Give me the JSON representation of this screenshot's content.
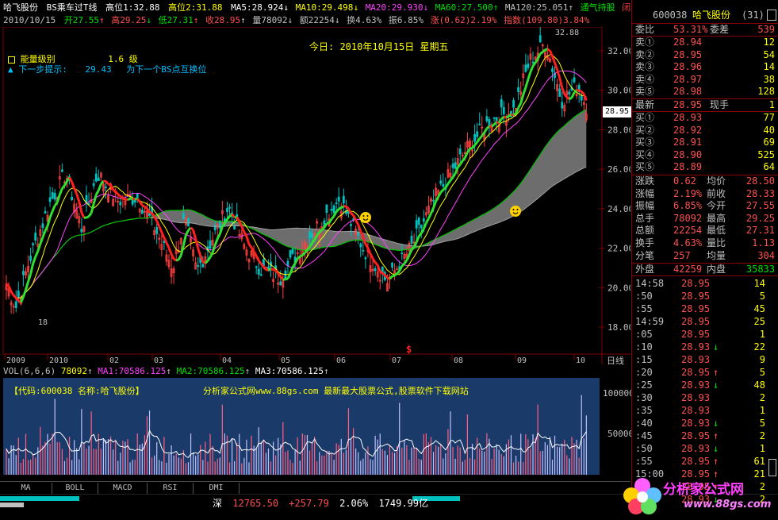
{
  "header": {
    "title": "哈飞股份",
    "formula": "BS乘车过T线",
    "high1": "高位1:32.88",
    "high2": "高位2:31.88",
    "ma5": "MA5:28.924",
    "ma10": "MA10:29.498",
    "ma20": "MA20:29.930",
    "ma60": "MA60:27.500",
    "ma120": "MA120:25.051",
    "tongqi": "通气持股",
    "xianqi": "闭气预",
    "date": "2010/10/15",
    "open": "开27.55",
    "high": "高29.25",
    "low": "低27.31",
    "close": "收28.95",
    "vol": "量78092",
    "amount": "额22254",
    "turnover": "换4.63%",
    "amplitude": "振6.85%",
    "change": "涨(0.62)2.19%",
    "index": "指数(109.80)3.84%"
  },
  "chart": {
    "today_label": "今日: 2010年10月15日 星期五",
    "energy_label": "能量级别",
    "energy_value": "1.6 级",
    "next_tip_label": "下一步提示:",
    "next_tip_value": "29.43",
    "next_tip_text": "为下一个BS点互换位",
    "peak_label": "32.88",
    "low_label": "18",
    "price_tag": "28.95",
    "y_ticks": [
      "32.00",
      "30.00",
      "28.00",
      "26.00",
      "24.00",
      "22.00",
      "20.00",
      "18.00"
    ],
    "x_ticks": [
      "2009",
      "2010",
      "02",
      "03",
      "04",
      "05",
      "06",
      "07",
      "08",
      "09",
      "10"
    ],
    "period": "日线",
    "ma_colors": {
      "ma5": "#ffffff",
      "ma10": "#ffff00",
      "ma20": "#ff40ff",
      "ma60": "#00c000",
      "ma120": "#c0c0c0"
    }
  },
  "volume": {
    "header": "VOL(6,6,6)",
    "vol": "78092",
    "ma1": "MA1:70586.125",
    "ma2": "MA2:70586.125",
    "ma3": "MA3:70586.125",
    "code_label": "【代码:600038 名称:哈飞股份】",
    "ad_text": "分析家公式网www.88gs.com 最新最大股票公式,股票软件下载网站",
    "y_ticks": [
      "100000",
      "50000"
    ]
  },
  "tabs": [
    "MA",
    "BOLL",
    "MACD",
    "RSI",
    "DMI"
  ],
  "status": {
    "market": "深",
    "index": "12765.50",
    "change": "+257.79",
    "pct": "2.06%",
    "amount": "1749.99亿"
  },
  "quote": {
    "code": "600038",
    "name": "哈飞股份",
    "count": "(31)",
    "weibi_label": "委比",
    "weibi": "53.31%",
    "weicha_label": "委差",
    "weicha": "539",
    "sell": [
      {
        "label": "卖⑤",
        "price": "28.98",
        "vol": "128"
      },
      {
        "label": "卖④",
        "price": "28.97",
        "vol": "38"
      },
      {
        "label": "卖③",
        "price": "28.96",
        "vol": "14"
      },
      {
        "label": "卖②",
        "price": "28.95",
        "vol": "54"
      },
      {
        "label": "卖①",
        "price": "28.94",
        "vol": "12"
      }
    ],
    "last_label": "最新",
    "last": "28.95",
    "xianshou_label": "现手",
    "xianshou": "1",
    "buy": [
      {
        "label": "买①",
        "price": "28.93",
        "vol": "77"
      },
      {
        "label": "买②",
        "price": "28.92",
        "vol": "40"
      },
      {
        "label": "买③",
        "price": "28.91",
        "vol": "69"
      },
      {
        "label": "买④",
        "price": "28.90",
        "vol": "525"
      },
      {
        "label": "买⑤",
        "price": "28.89",
        "vol": "64"
      }
    ],
    "stats": [
      {
        "l1": "涨跌",
        "v1": "0.62",
        "l2": "均价",
        "v2": "28.50"
      },
      {
        "l1": "涨幅",
        "v1": "2.19%",
        "l2": "前收",
        "v2": "28.33"
      },
      {
        "l1": "振幅",
        "v1": "6.85%",
        "l2": "今开",
        "v2": "27.55"
      },
      {
        "l1": "总手",
        "v1": "78092",
        "l2": "最高",
        "v2": "29.25"
      },
      {
        "l1": "总额",
        "v1": "22254",
        "l2": "最低",
        "v2": "27.31"
      },
      {
        "l1": "换手",
        "v1": "4.63%",
        "l2": "量比",
        "v2": "1.13"
      },
      {
        "l1": "分笔",
        "v1": "257",
        "l2": "均量",
        "v2": "304"
      }
    ],
    "outer_label": "外盘",
    "outer": "42259",
    "inner_label": "内盘",
    "inner": "35833",
    "ticks": [
      {
        "t": "14:58",
        "p": "28.95",
        "a": "",
        "v": "14"
      },
      {
        "t": ":50",
        "p": "28.95",
        "a": "",
        "v": "5"
      },
      {
        "t": ":55",
        "p": "28.95",
        "a": "",
        "v": "45"
      },
      {
        "t": "14:59",
        "p": "28.95",
        "a": "",
        "v": "25"
      },
      {
        "t": ":05",
        "p": "28.95",
        "a": "",
        "v": "1"
      },
      {
        "t": ":10",
        "p": "28.93",
        "a": "↓",
        "v": "22"
      },
      {
        "t": ":15",
        "p": "28.93",
        "a": "",
        "v": "9"
      },
      {
        "t": ":20",
        "p": "28.95",
        "a": "↑",
        "v": "5"
      },
      {
        "t": ":25",
        "p": "28.93",
        "a": "↓",
        "v": "48"
      },
      {
        "t": ":30",
        "p": "28.93",
        "a": "",
        "v": "2"
      },
      {
        "t": ":35",
        "p": "28.93",
        "a": "",
        "v": "1"
      },
      {
        "t": ":40",
        "p": "28.93",
        "a": "↓",
        "v": "5"
      },
      {
        "t": ":45",
        "p": "28.95",
        "a": "↑",
        "v": "2"
      },
      {
        "t": ":50",
        "p": "28.93",
        "a": "↓",
        "v": "1"
      },
      {
        "t": ":55",
        "p": "28.95",
        "a": "↑",
        "v": "61"
      },
      {
        "t": "15:00",
        "p": "28.95",
        "a": "↑",
        "v": "21"
      },
      {
        "t": "",
        "p": "28.95",
        "a": "↑",
        "v": "2"
      },
      {
        "t": "",
        "p": "28.93",
        "a": "↓",
        "v": "2"
      }
    ]
  },
  "watermark": {
    "brand": "分析家公式网",
    "url": "www.88gs.com"
  }
}
